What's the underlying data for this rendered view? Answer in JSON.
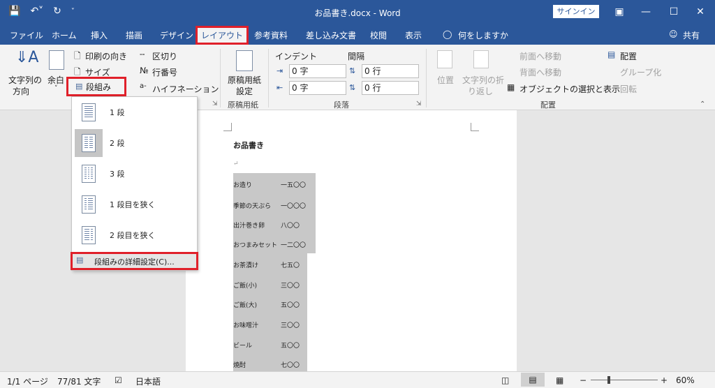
{
  "window": {
    "title": "お品書き.docx - Word",
    "signin": "サインイン"
  },
  "tabs": [
    "ファイル",
    "ホーム",
    "挿入",
    "描画",
    "デザイン",
    "レイアウト",
    "参考資料",
    "差し込み文書",
    "校閲",
    "表示",
    "何をしますか"
  ],
  "share": "共有",
  "ribbon": {
    "text_direction": [
      "文字列の",
      "方向"
    ],
    "margins": "余白",
    "orientation": "印刷の向き",
    "size": "サイズ",
    "columns": "段組み",
    "breaks": "区切り",
    "line_numbers": "行番号",
    "hyphenation": "ハイフネーション",
    "genko": [
      "原稿用紙",
      "設定"
    ],
    "genko_group": "原稿用紙",
    "indent_label": "インデント",
    "spacing_label": "間隔",
    "indent_left": "0 字",
    "indent_right": "0 字",
    "spacing_before": "0 行",
    "spacing_after": "0 行",
    "paragraph_group": "段落",
    "position": "位置",
    "wrap": [
      "文字列の折",
      "り返し"
    ],
    "bring_forward": "前面へ移動",
    "send_backward": "背面へ移動",
    "selection_pane": "オブジェクトの選択と表示",
    "align": "配置",
    "group": "グループ化",
    "rotate": "回転",
    "arrange_group": "配置"
  },
  "dropdown": {
    "items": [
      "1 段",
      "2 段",
      "3 段",
      "1 段目を狭く",
      "2 段目を狭く"
    ],
    "more": "段組みの詳細設定(C)..."
  },
  "document": {
    "heading": "お品書き",
    "menu": [
      [
        "お造り",
        "一五〇〇"
      ],
      [
        "季節の天ぷら",
        "一〇〇〇"
      ],
      [
        "出汁巻き卵",
        "八〇〇"
      ],
      [
        "おつまみセット",
        "一二〇〇"
      ],
      [
        "お茶漬け",
        "七五〇"
      ],
      [
        "ご飯(小)",
        "三〇〇"
      ],
      [
        "ご飯(大)",
        "五〇〇"
      ],
      [
        "お味噌汁",
        "三〇〇"
      ],
      [
        "ビール",
        "五〇〇"
      ],
      [
        "焼酎",
        "七〇〇"
      ]
    ]
  },
  "status": {
    "page": "1/1 ページ",
    "words": "77/81 文字",
    "language": "日本語",
    "zoom": "60%"
  }
}
